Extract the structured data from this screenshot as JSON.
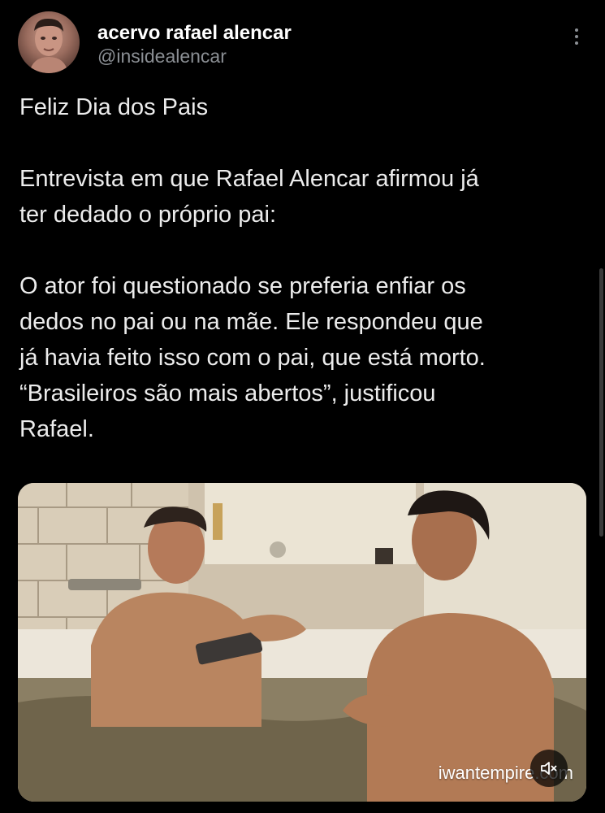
{
  "author": {
    "display_name": "acervo rafael alencar",
    "handle": "@insidealencar",
    "avatar_icon": "profile-photo"
  },
  "menu": {
    "more_icon": "more-vertical-icon"
  },
  "tweet": {
    "paragraphs": [
      "Feliz Dia dos Pais",
      "Entrevista em que Rafael Alencar afirmou já\nter dedado o próprio pai:",
      "O ator foi questionado se preferia enfiar os\ndedos no pai ou na mãe. Ele respondeu que\njá havia feito isso com o pai, que está morto.\n“Brasileiros são mais abertos”, justificou\nRafael."
    ]
  },
  "media": {
    "watermark": "iwantempire.com",
    "mute_icon": "speaker-muted-icon"
  },
  "colors": {
    "background": "#000000",
    "text": "#e7e9ea",
    "secondary_text": "#8b8f94"
  }
}
